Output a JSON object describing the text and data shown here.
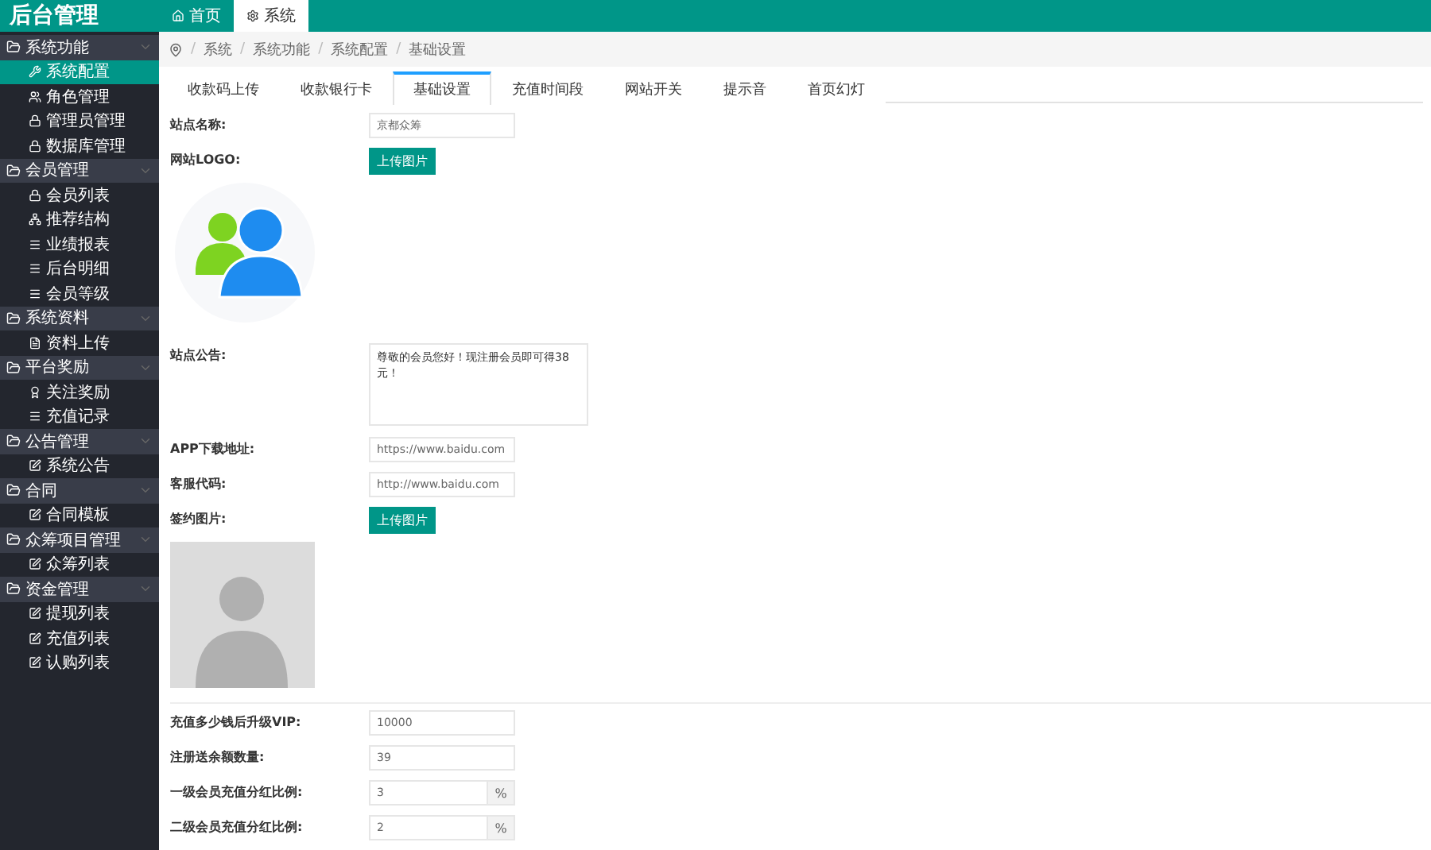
{
  "header": {
    "title": "后台管理",
    "tabs": [
      {
        "label": "首页",
        "selected": false
      },
      {
        "label": "系统",
        "selected": true
      }
    ]
  },
  "sidebar": {
    "groups": [
      {
        "label": "系统功能",
        "expanded": true,
        "items": [
          {
            "label": "系统配置",
            "selected": true
          },
          {
            "label": "角色管理",
            "selected": false
          },
          {
            "label": "管理员管理",
            "selected": false
          },
          {
            "label": "数据库管理",
            "selected": false
          }
        ]
      },
      {
        "label": "会员管理",
        "expanded": true,
        "items": [
          {
            "label": "会员列表",
            "selected": false
          },
          {
            "label": "推荐结构",
            "selected": false
          },
          {
            "label": "业绩报表",
            "selected": false
          },
          {
            "label": "后台明细",
            "selected": false
          },
          {
            "label": "会员等级",
            "selected": false
          }
        ]
      },
      {
        "label": "系统资料",
        "expanded": true,
        "items": [
          {
            "label": "资料上传",
            "selected": false
          }
        ]
      },
      {
        "label": "平台奖励",
        "expanded": true,
        "items": [
          {
            "label": "关注奖励",
            "selected": false
          },
          {
            "label": "充值记录",
            "selected": false
          }
        ]
      },
      {
        "label": "公告管理",
        "expanded": true,
        "items": [
          {
            "label": "系统公告",
            "selected": false
          }
        ]
      },
      {
        "label": "合同",
        "expanded": true,
        "items": [
          {
            "label": "合同模板",
            "selected": false
          }
        ]
      },
      {
        "label": "众筹项目管理",
        "expanded": true,
        "items": [
          {
            "label": "众筹列表",
            "selected": false
          }
        ]
      },
      {
        "label": "资金管理",
        "expanded": true,
        "items": [
          {
            "label": "提现列表",
            "selected": false
          },
          {
            "label": "充值列表",
            "selected": false
          },
          {
            "label": "认购列表",
            "selected": false
          }
        ]
      }
    ]
  },
  "breadcrumb": {
    "separator": "/",
    "items": [
      "系统",
      "系统功能",
      "系统配置",
      "基础设置"
    ]
  },
  "tabs": [
    {
      "label": "收款码上传",
      "selected": false
    },
    {
      "label": "收款银行卡",
      "selected": false
    },
    {
      "label": "基础设置",
      "selected": true
    },
    {
      "label": "充值时间段",
      "selected": false
    },
    {
      "label": "网站开关",
      "selected": false
    },
    {
      "label": "提示音",
      "selected": false
    },
    {
      "label": "首页幻灯",
      "selected": false
    }
  ],
  "form": [
    {
      "kind": "text",
      "label": "站点名称:",
      "value": "京都众筹"
    },
    {
      "kind": "upload",
      "label": "网站LOGO:",
      "button": "上传图片"
    },
    {
      "kind": "logo"
    },
    {
      "kind": "textarea",
      "label": "站点公告:",
      "value": "尊敬的会员您好！现注册会员即可得38元！"
    },
    {
      "kind": "text",
      "label": "APP下载地址:",
      "value": "https://www.baidu.com"
    },
    {
      "kind": "text",
      "label": "客服代码:",
      "value": "http://www.baidu.com"
    },
    {
      "kind": "upload",
      "label": "签约图片:",
      "button": "上传图片"
    },
    {
      "kind": "image"
    },
    {
      "kind": "divider"
    },
    {
      "kind": "text",
      "label": "充值多少钱后升级VIP:",
      "value": "10000"
    },
    {
      "kind": "text",
      "label": "注册送余额数量:",
      "value": "39"
    },
    {
      "kind": "percent",
      "label": "一级会员充值分红比例:",
      "value": "3",
      "unit": "%"
    },
    {
      "kind": "percent",
      "label": "二级会员充值分红比例:",
      "value": "2",
      "unit": "%"
    }
  ]
}
